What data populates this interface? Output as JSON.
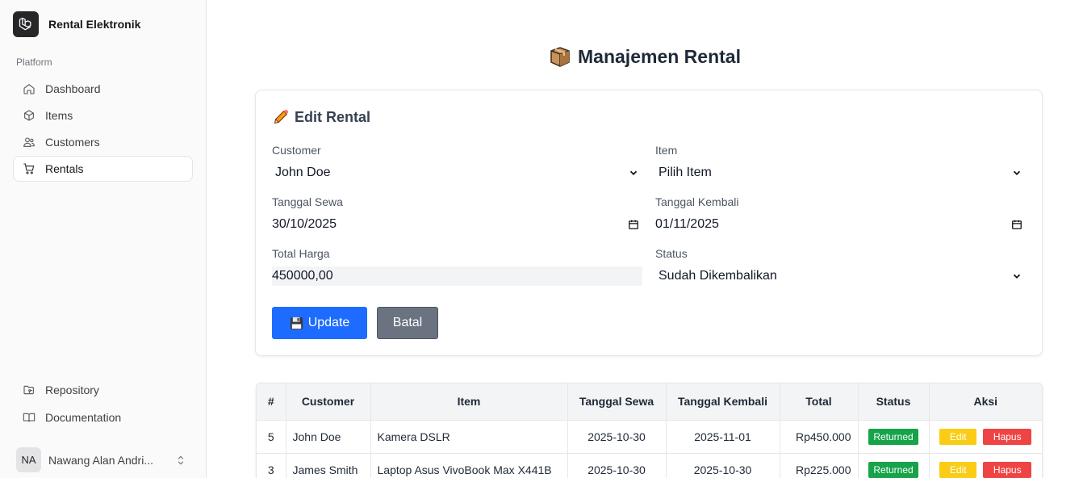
{
  "app": {
    "name": "Rental Elektronik"
  },
  "sidebar": {
    "group_label": "Platform",
    "items": [
      {
        "label": "Dashboard",
        "icon": "home-icon"
      },
      {
        "label": "Items",
        "icon": "cube-icon"
      },
      {
        "label": "Customers",
        "icon": "users-icon"
      },
      {
        "label": "Rentals",
        "icon": "cart-icon",
        "active": true
      }
    ],
    "bottom_items": [
      {
        "label": "Repository",
        "icon": "folder-git-icon"
      },
      {
        "label": "Documentation",
        "icon": "book-open-icon"
      }
    ],
    "user": {
      "initials": "NA",
      "name": "Nawang Alan Andri..."
    }
  },
  "page": {
    "title": "Manajemen Rental"
  },
  "form": {
    "title": "Edit Rental",
    "customer": {
      "label": "Customer",
      "value": "John Doe"
    },
    "item": {
      "label": "Item",
      "value": "Pilih Item"
    },
    "tanggal_sewa": {
      "label": "Tanggal Sewa",
      "value": "30/10/2025"
    },
    "tanggal_kembali": {
      "label": "Tanggal Kembali",
      "value": "01/11/2025"
    },
    "total_harga": {
      "label": "Total Harga",
      "value": "450000,00"
    },
    "status": {
      "label": "Status",
      "value": "Sudah Dikembalikan"
    },
    "update_label": "Update",
    "cancel_label": "Batal"
  },
  "table": {
    "headers": [
      "#",
      "Customer",
      "Item",
      "Tanggal Sewa",
      "Tanggal Kembali",
      "Total",
      "Status",
      "Aksi"
    ],
    "rows": [
      {
        "id": "5",
        "customer": "John Doe",
        "item": "Kamera DSLR",
        "sewa": "2025-10-30",
        "kembali": "2025-11-01",
        "total": "Rp450.000",
        "status": "Returned",
        "edit": "Edit",
        "hapus": "Hapus"
      },
      {
        "id": "3",
        "customer": "James Smith",
        "item": "Laptop Asus VivoBook Max X441B",
        "sewa": "2025-10-30",
        "kembali": "2025-10-30",
        "total": "Rp225.000",
        "status": "Returned",
        "edit": "Edit",
        "hapus": "Hapus"
      }
    ]
  },
  "colors": {
    "primary": "#1d6cff",
    "secondary": "#6b7280",
    "success": "#16a34a",
    "warning": "#facc15",
    "danger": "#ef4444"
  }
}
